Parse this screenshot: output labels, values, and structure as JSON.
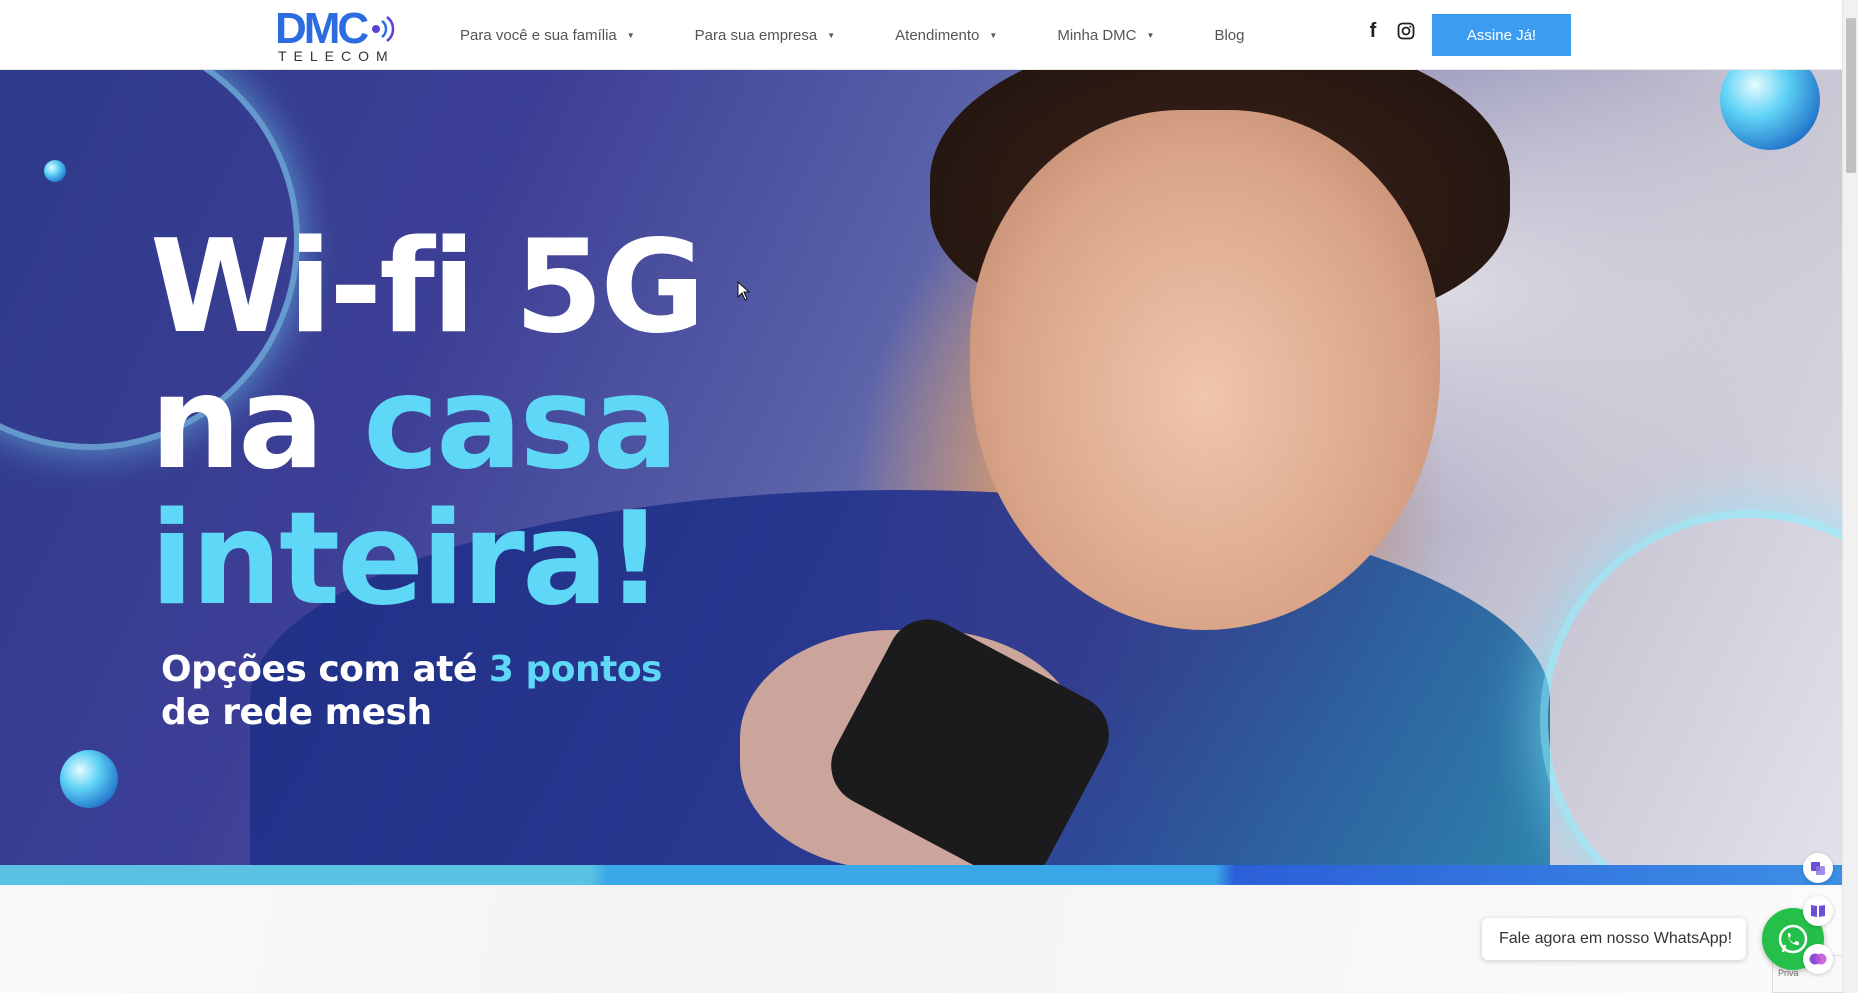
{
  "header": {
    "logo": {
      "brand": "DMC",
      "tagline": "TELECOM"
    },
    "nav": [
      {
        "label": "Para você e sua família",
        "has_dropdown": true
      },
      {
        "label": "Para sua empresa",
        "has_dropdown": true
      },
      {
        "label": "Atendimento",
        "has_dropdown": true
      },
      {
        "label": "Minha DMC",
        "has_dropdown": true
      },
      {
        "label": "Blog",
        "has_dropdown": false
      }
    ],
    "social": {
      "facebook_icon": "f",
      "instagram_icon": "instagram-icon"
    },
    "cta_label": "Assine Já!"
  },
  "hero": {
    "line1": "Wi-fi 5G",
    "line2_white": "na ",
    "line2_accent": "casa",
    "line3": "inteira!",
    "sub_line1_white": "Opções com até ",
    "sub_line1_accent": "3 pontos",
    "sub_line2": "de rede mesh"
  },
  "whatsapp": {
    "message": "Fale agora em nosso WhatsApp!"
  },
  "recaptcha": {
    "label": "Priva"
  },
  "colors": {
    "cta": "#3b9cf0",
    "accent": "#5fd8f7",
    "whatsapp": "#25c04a",
    "brand_blue": "#2c6be0"
  }
}
